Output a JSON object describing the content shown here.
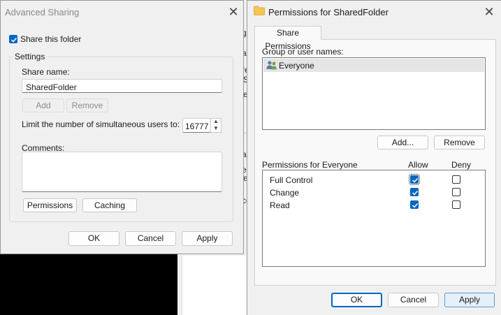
{
  "background_window": {
    "fragments": [
      "g",
      "a",
      "re",
      "S",
      "e",
      "er",
      "e",
      "a",
      "cc"
    ]
  },
  "advanced_sharing": {
    "title": "Advanced Sharing",
    "share_this_folder": "Share this folder",
    "settings_group": "Settings",
    "share_name_label": "Share name:",
    "share_name_value": "SharedFolder",
    "add_button": "Add",
    "remove_button": "Remove",
    "limit_label": "Limit the number of simultaneous users to:",
    "limit_value": "16777",
    "comments_label": "Comments:",
    "comments_value": "",
    "permissions_button": "Permissions",
    "caching_button": "Caching",
    "ok_button": "OK",
    "cancel_button": "Cancel",
    "apply_button": "Apply"
  },
  "permissions_dialog": {
    "title": "Permissions for SharedFolder",
    "tab": "Share Permissions",
    "group_label": "Group or user names:",
    "users": [
      {
        "name": "Everyone",
        "icon": "users-icon"
      }
    ],
    "add_button": "Add...",
    "remove_button": "Remove",
    "permissions_for_label": "Permissions for Everyone",
    "allow_header": "Allow",
    "deny_header": "Deny",
    "permissions": [
      {
        "name": "Full Control",
        "allow": true,
        "deny": false
      },
      {
        "name": "Change",
        "allow": true,
        "deny": false
      },
      {
        "name": "Read",
        "allow": true,
        "deny": false
      }
    ],
    "ok_button": "OK",
    "cancel_button": "Cancel",
    "apply_button": "Apply"
  },
  "colors": {
    "accent": "#0067c0",
    "dialog_bg": "#f0f0f0",
    "selection_bg": "#e5e5e5"
  }
}
